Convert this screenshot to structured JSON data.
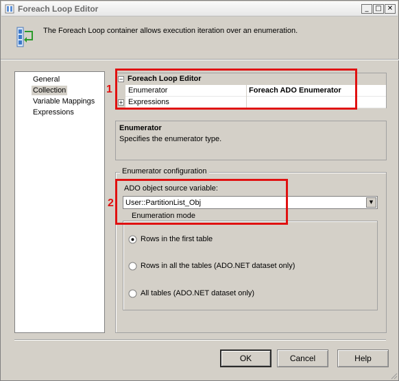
{
  "window": {
    "title": "Foreach Loop Editor"
  },
  "header": {
    "description": "The Foreach Loop container allows execution iteration over an enumeration."
  },
  "nav": {
    "items": [
      {
        "label": "General"
      },
      {
        "label": "Collection"
      },
      {
        "label": "Variable Mappings"
      },
      {
        "label": "Expressions"
      }
    ]
  },
  "property_grid": {
    "category": "Foreach Loop Editor",
    "rows": [
      {
        "name": "Enumerator",
        "value": "Foreach ADO Enumerator"
      },
      {
        "name": "Expressions",
        "value": ""
      }
    ]
  },
  "description_panel": {
    "title": "Enumerator",
    "text": "Specifies the enumerator type."
  },
  "enumerator_config": {
    "legend": "Enumerator configuration",
    "source_label": "ADO object source variable:",
    "source_value": "User::PartitionList_Obj",
    "mode_legend": "Enumeration mode",
    "modes": [
      {
        "label": "Rows in the first table",
        "selected": true
      },
      {
        "label": "Rows in all the tables (ADO.NET dataset only)",
        "selected": false
      },
      {
        "label": "All tables (ADO.NET dataset only)",
        "selected": false
      }
    ]
  },
  "buttons": {
    "ok": "OK",
    "cancel": "Cancel",
    "help": "Help"
  },
  "annotations": {
    "marker1": "1",
    "marker2": "2",
    "color": "#e01010"
  }
}
